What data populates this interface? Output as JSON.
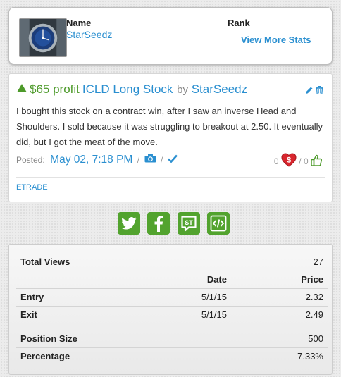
{
  "profile": {
    "name_label": "Name",
    "name": "StarSeedz",
    "rank_label": "Rank",
    "view_more": "View More Stats"
  },
  "trade": {
    "profit": "$65 profit",
    "ticker": "ICLD Long Stock",
    "by": "by",
    "author": "StarSeedz",
    "text": "I bought this stock on a contract win, after I saw an inverse Head and Shoulders. I sold because it was struggling to breakout at 2.50. It eventually did, but I got the meat of the move.",
    "posted_label": "Posted:",
    "posted_date": "May 02, 7:18 PM",
    "sep": "/",
    "down_votes": "0",
    "up_votes": "0",
    "broker": "ETRADE",
    "profit_color": "#4d9a2a",
    "link_color": "#2a8fd0"
  },
  "share": {
    "icons": [
      "twitter-icon",
      "facebook-icon",
      "stocktwits-icon",
      "embed-icon"
    ],
    "st_label": "ST",
    "color": "#52a32e"
  },
  "stats": {
    "total_views_label": "Total Views",
    "total_views": "27",
    "date_header": "Date",
    "price_header": "Price",
    "entry_label": "Entry",
    "entry_date": "5/1/15",
    "entry_price": "2.32",
    "exit_label": "Exit",
    "exit_date": "5/1/15",
    "exit_price": "2.49",
    "position_size_label": "Position Size",
    "position_size": "500",
    "percentage_label": "Percentage",
    "percentage": "7.33%"
  }
}
